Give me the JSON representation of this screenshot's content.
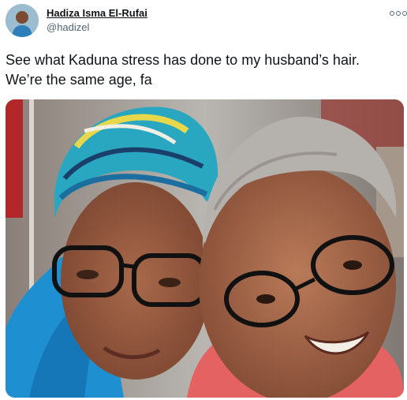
{
  "tweet": {
    "author_name": "Hadiza Isma El-Rufai",
    "author_handle": "@hadizel",
    "text": "See what Kaduna stress has done to my husband’s hair.\nWe’re the same age, fa"
  },
  "icons": {
    "avatar": "profile-photo",
    "more": "more-options-icon"
  },
  "colors": {
    "text_primary": "#0f1419",
    "text_secondary": "#536471",
    "background": "#ffffff"
  }
}
